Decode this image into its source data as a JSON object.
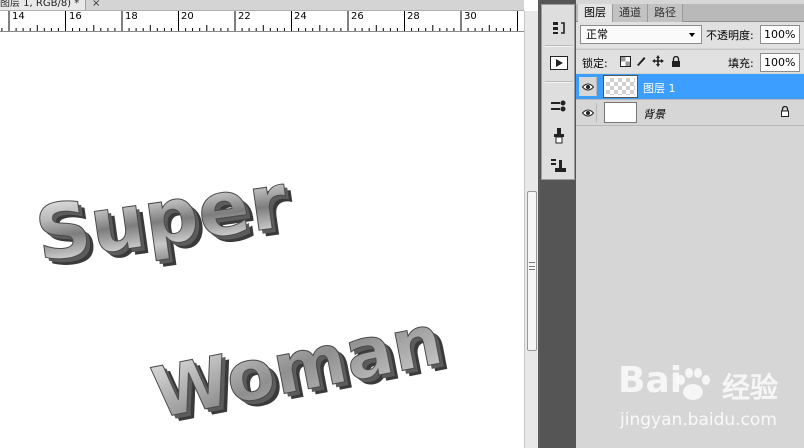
{
  "document": {
    "tab_title": "图层 1, RGB/8) *",
    "close_glyph": "×",
    "ruler_labels": [
      "14",
      "16",
      "18",
      "20",
      "22",
      "24",
      "26",
      "28",
      "30"
    ],
    "canvas_text": [
      "Super",
      "Woman"
    ]
  },
  "toolstrip": {
    "tools": [
      "history-icon",
      "actions-icon",
      "brush-presets-icon",
      "clone-source-icon",
      "tool-presets-icon"
    ]
  },
  "layers_panel": {
    "tabs": [
      {
        "label": "图层",
        "active": true
      },
      {
        "label": "通道",
        "active": false
      },
      {
        "label": "路径",
        "active": false
      }
    ],
    "blend_mode": "正常",
    "opacity_label": "不透明度:",
    "opacity_value": "100%",
    "lock_label": "锁定:",
    "fill_label": "填充:",
    "fill_value": "100%",
    "layers": [
      {
        "name": "图层 1",
        "selected": true,
        "visible": true,
        "locked": false
      },
      {
        "name": "背景",
        "selected": false,
        "visible": true,
        "locked": true
      }
    ]
  },
  "watermark": {
    "logo_left": "Bai",
    "logo_right": "经验",
    "url": "jingyan.baidu.com"
  },
  "colors": {
    "selection": "#3c9eff",
    "panel_bg": "#d6d6d6",
    "toolstrip_bg": "#555555"
  }
}
